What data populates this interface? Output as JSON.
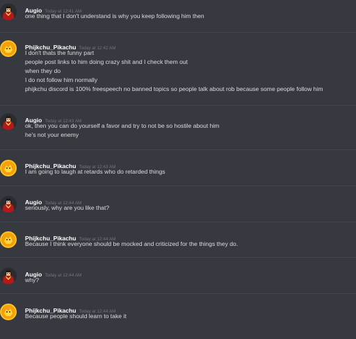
{
  "messages": [
    {
      "author": "Augio",
      "timestamp": "Today at 12:41 AM",
      "avatar": "vampire-avatar",
      "lines": [
        "one thing that I don't understand is why you keep following him then"
      ]
    },
    {
      "author": "Phijkchu_Pikachu",
      "timestamp": "Today at 12:42 AM",
      "avatar": "pikachu-avatar",
      "lines": [
        "I don't thats the funny part",
        "people post links to him doing crazy shit and I check them out",
        "when they do",
        "I do not follow him normally",
        "phijkchu discord is 100% freespeech no banned topics so people talk about rob because some people follow him"
      ]
    },
    {
      "author": "Augio",
      "timestamp": "Today at 12:43 AM",
      "avatar": "vampire-avatar",
      "lines": [
        "ok, then you can do yourself a favor and try to not be so hostile about him",
        "he's not your enemy"
      ]
    },
    {
      "author": "Phijkchu_Pikachu",
      "timestamp": "Today at 12:43 AM",
      "avatar": "pikachu-avatar",
      "lines": [
        "I am going to laugh at retards who do retarded things"
      ]
    },
    {
      "author": "Augio",
      "timestamp": "Today at 12:44 AM",
      "avatar": "vampire-avatar",
      "lines": [
        "seriously, why are you like that?"
      ]
    },
    {
      "author": "Phijkchu_Pikachu",
      "timestamp": "Today at 12:44 AM",
      "avatar": "pikachu-avatar",
      "lines": [
        "Because I think everyone should be mocked and criticized for the things they do."
      ]
    },
    {
      "author": "Augio",
      "timestamp": "Today at 12:44 AM",
      "avatar": "vampire-avatar",
      "lines": [
        "why?"
      ]
    },
    {
      "author": "Phijkchu_Pikachu",
      "timestamp": "Today at 12:44 AM",
      "avatar": "pikachu-avatar",
      "lines": [
        "Because people should learn to take it"
      ]
    }
  ],
  "colors": {
    "background": "#36393f",
    "username": "#ffffff",
    "timestamp": "#72767d",
    "text": "#dcddde",
    "divider": "#42454a"
  }
}
